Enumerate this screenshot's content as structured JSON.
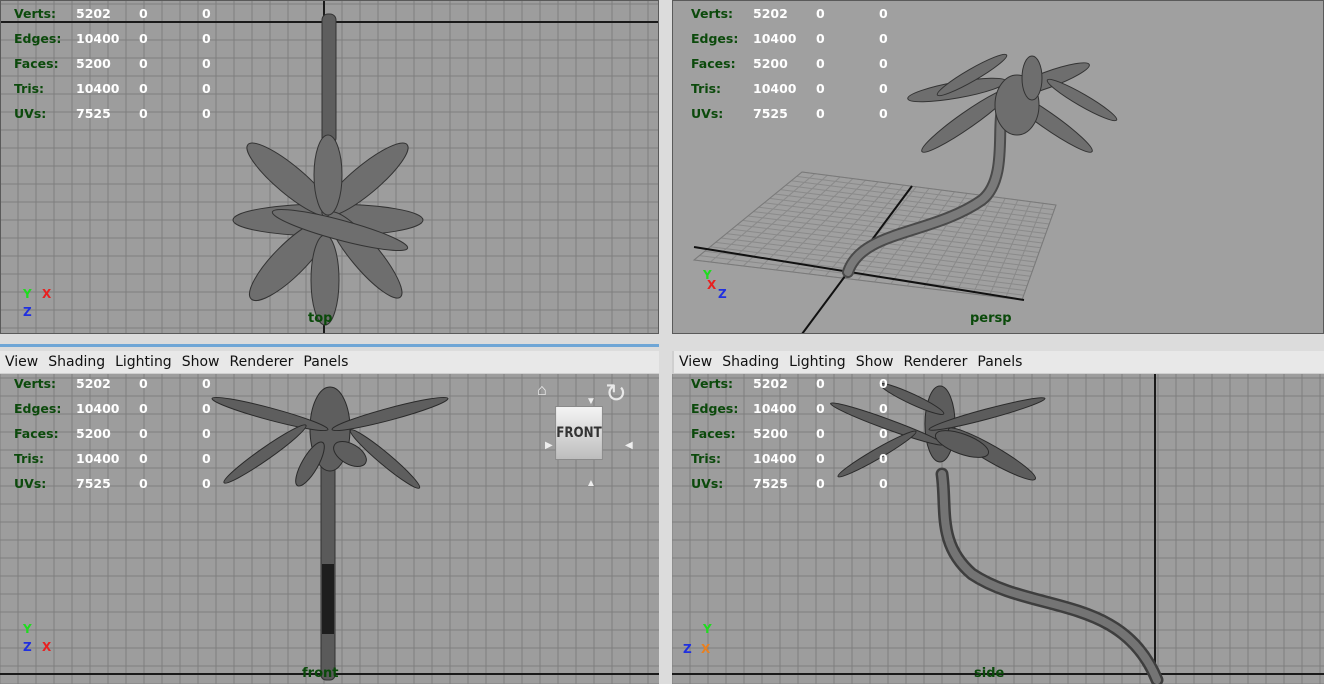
{
  "menu": [
    "View",
    "Shading",
    "Lighting",
    "Show",
    "Renderer",
    "Panels"
  ],
  "hud": {
    "labels": [
      "Verts:",
      "Edges:",
      "Faces:",
      "Tris:",
      "UVs:"
    ],
    "col1": [
      "5202",
      "10400",
      "5200",
      "10400",
      "7525"
    ],
    "col2": [
      "0",
      "0",
      "0",
      "0",
      "0"
    ],
    "col3": [
      "0",
      "0",
      "0",
      "0",
      "0"
    ]
  },
  "panels": {
    "top": {
      "camera": "top"
    },
    "persp": {
      "camera": "persp"
    },
    "front": {
      "camera": "front"
    },
    "side": {
      "camera": "side"
    }
  },
  "axes": {
    "x": "X",
    "y": "Y",
    "z": "Z"
  },
  "viewcube": {
    "face": "FRONT"
  },
  "colors": {
    "viewport_bg": "#9d9d9d",
    "grid": "#7e7e7e",
    "grid_axis": "#1a1a1a",
    "hud_label": "#0c4a0c",
    "menu_bg": "#e8e8e8"
  }
}
